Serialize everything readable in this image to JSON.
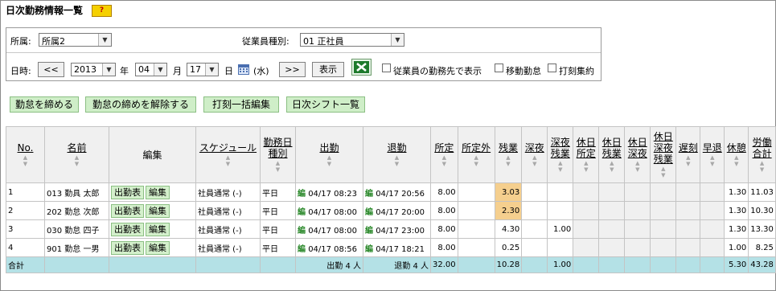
{
  "header": {
    "title": "日次勤務情報一覧",
    "help": "?"
  },
  "filters": {
    "affiliation_label": "所属:",
    "affiliation_value": "所属2",
    "emp_type_label": "従業員種別:",
    "emp_type_value": "01 正社員",
    "datetime_label": "日時:",
    "prev": "<<",
    "year": "2013",
    "year_suffix": "年",
    "month": "04",
    "month_suffix": "月",
    "day": "17",
    "day_suffix": "日",
    "weekday": "(水)",
    "next": ">>",
    "show": "表示",
    "cb_workplace": "従業員の勤務先で表示",
    "cb_move": "移動勤怠",
    "cb_stamp": "打刻集約"
  },
  "actions": {
    "close": "勤怠を締める",
    "unclose": "勤怠の締めを解除する",
    "bulk_edit": "打刻一括編集",
    "shift": "日次シフト一覧"
  },
  "table": {
    "headers": [
      "No.",
      "名前",
      "編集",
      "スケジュール",
      "勤務日種別",
      "出勤",
      "退勤",
      "所定",
      "所定外",
      "残業",
      "深夜",
      "深夜残業",
      "休日所定",
      "休日残業",
      "休日深夜",
      "休日深夜残業",
      "遅刻",
      "早退",
      "休憩",
      "労働合計"
    ],
    "attendance_btn": "出勤表",
    "edit_btn": "編集",
    "edit_mark": "編",
    "rows": [
      {
        "no": "1",
        "name": "013 勤具 太郎",
        "schedule": "社員通常 (-)",
        "daytype": "平日",
        "in": "04/17 08:23",
        "out": "04/17 20:56",
        "fixed": "8.00",
        "extra": "",
        "overtime": "3.03",
        "night": "",
        "night_ot": "",
        "break": "1.30",
        "total": "11.03"
      },
      {
        "no": "2",
        "name": "202 勤怠 次郎",
        "schedule": "社員通常 (-)",
        "daytype": "平日",
        "in": "04/17 08:00",
        "out": "04/17 20:00",
        "fixed": "8.00",
        "extra": "",
        "overtime": "2.30",
        "night": "",
        "night_ot": "",
        "break": "1.30",
        "total": "10.30"
      },
      {
        "no": "3",
        "name": "030 勤怠 四子",
        "schedule": "社員通常 (-)",
        "daytype": "平日",
        "in": "04/17 08:00",
        "out": "04/17 23:00",
        "fixed": "8.00",
        "extra": "",
        "overtime": "4.30",
        "night": "",
        "night_ot": "1.00",
        "break": "1.30",
        "total": "13.30"
      },
      {
        "no": "4",
        "name": "901 勤怠 一男",
        "schedule": "社員通常 (-)",
        "daytype": "平日",
        "in": "04/17 08:56",
        "out": "04/17 18:21",
        "fixed": "8.00",
        "extra": "",
        "overtime": "0.25",
        "night": "",
        "night_ot": "",
        "break": "1.00",
        "total": "8.25"
      }
    ],
    "totals": {
      "label": "合計",
      "in": "出勤 4 人",
      "out": "退勤 4 人",
      "fixed": "32.00",
      "overtime": "10.28",
      "night_ot": "1.00",
      "break": "5.30",
      "total": "43.28"
    }
  }
}
